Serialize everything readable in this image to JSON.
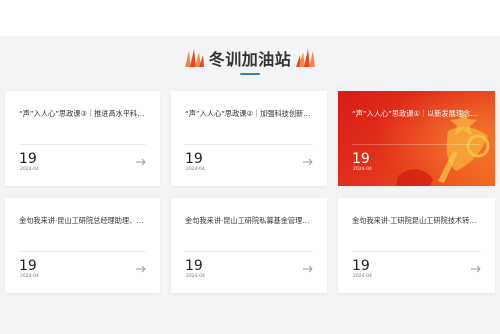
{
  "section": {
    "title": "冬训加油站"
  },
  "cards": [
    {
      "title": "“声”入人心”思政课③｜推进高水平科…",
      "day": "19",
      "ym": "2024-04"
    },
    {
      "title": "“声”入人心”思政课②｜加强科技创新…",
      "day": "19",
      "ym": "2024-04"
    },
    {
      "title": "“声”入人心”思政课①｜以新发展理念…",
      "day": "19",
      "ym": "2024-04",
      "featured": true
    },
    {
      "title": "金句我来讲·昆山工研院总经理助理、产业…",
      "day": "19",
      "ym": "2024-04"
    },
    {
      "title": "金句我来讲·昆山工研院私募基金管理有限…",
      "day": "19",
      "ym": "2024-04"
    },
    {
      "title": "金句我来讲·工研院昆山工研院技术转移部…",
      "day": "19",
      "ym": "2024-04"
    }
  ],
  "colors": {
    "accent": "#2f80d1",
    "flame": "#e8452a",
    "featured_bg": "#d81c16"
  },
  "icons": {
    "flame": "flame-decoration-icon",
    "arrow": "arrow-right-icon"
  }
}
